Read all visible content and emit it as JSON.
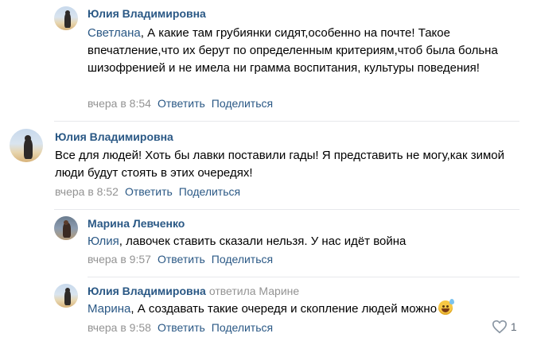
{
  "comments": [
    {
      "author": "Юлия Владимировна",
      "mention": "Светлана",
      "text_after_mention": ", А какие там грубиянки сидят,особенно на почте! Такое впечатление,что их берут по определенным критериям,чтоб была больна шизофренией и не имела ни грамма воспитания, культуры поведения!",
      "time": "вчера в 8:54",
      "reply_label": "Ответить",
      "share_label": "Поделиться"
    },
    {
      "author": "Юлия Владимировна",
      "text": "Все для людей! Хоть бы лавки поставили гады! Я представить не могу,как зимой люди будут стоять в этих очередях!",
      "time": "вчера в 8:52",
      "reply_label": "Ответить",
      "share_label": "Поделиться"
    },
    {
      "author": "Марина Левченко",
      "mention": "Юлия",
      "text_after_mention": ", лавочек ставить сказали нельзя. У нас идёт война",
      "time": "вчера в 9:57",
      "reply_label": "Ответить",
      "share_label": "Поделиться"
    },
    {
      "author": "Юлия Владимировна",
      "replied_to": "ответила Марине",
      "mention": "Марина",
      "text_after_mention": ", А создавать такие очередя и скопление людей можно",
      "emoji_icon": "sweat-smile-emoji",
      "time": "вчера в 9:58",
      "reply_label": "Ответить",
      "share_label": "Поделиться",
      "likes": "1"
    }
  ],
  "colors": {
    "link": "#2a5885",
    "meta": "#939393",
    "separator": "#e7e8ec"
  }
}
